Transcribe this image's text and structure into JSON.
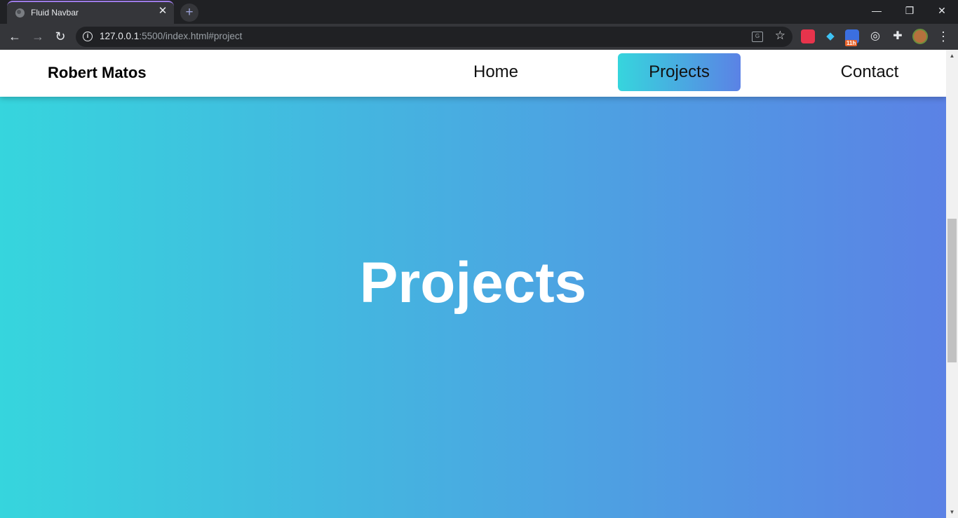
{
  "browser": {
    "tab_title": "Fluid Navbar",
    "tab_close": "✕",
    "new_tab": "+",
    "url_host": "127.0.0.1",
    "url_rest": ":5500/index.html#project",
    "window_controls": {
      "minimize": "—",
      "restore": "❐",
      "close": "✕"
    },
    "nav": {
      "back": "←",
      "forward": "→",
      "reload": "↻"
    },
    "extension_badge": "11h"
  },
  "page": {
    "brand": "Robert Matos",
    "nav_links": [
      {
        "label": "Home",
        "active": false
      },
      {
        "label": "Projects",
        "active": true
      },
      {
        "label": "Contact",
        "active": false
      }
    ],
    "hero_title": "Projects"
  },
  "colors": {
    "gradient_start": "#36d5dd",
    "gradient_end": "#5b82e5",
    "navbar_bg": "#ffffff",
    "hero_text": "#ffffff"
  }
}
